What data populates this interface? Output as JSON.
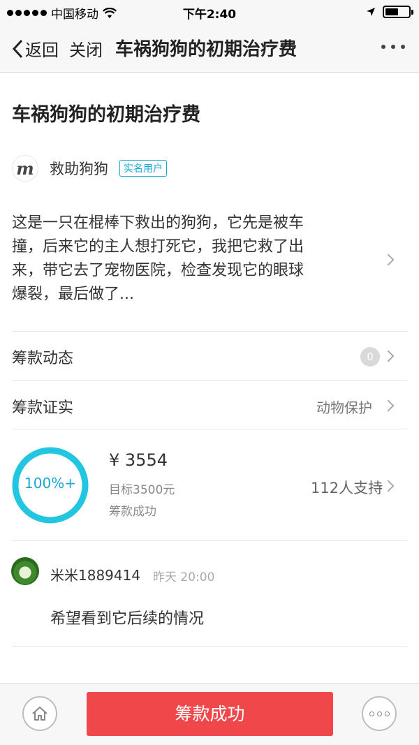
{
  "status_bar": {
    "carrier": "中国移动",
    "time": "下午2:40"
  },
  "nav": {
    "back_label": "返回",
    "close_label": "关闭",
    "title": "车祸狗狗的初期治疗费"
  },
  "post": {
    "title": "车祸狗狗的初期治疗费",
    "author": {
      "logo_letter": "m",
      "name": "救助狗狗",
      "badge": "实名用户"
    },
    "description_lines": [
      "这是一只在棍棒下救出的狗狗，它先是被车",
      "撞，后来它的主人想打死它，我把它救了出",
      "来，带它去了宠物医院，检查发现它的眼球",
      "爆裂，最后做了..."
    ]
  },
  "rows": {
    "updates": {
      "label": "筹款动态",
      "count": "0"
    },
    "verify": {
      "label": "筹款证实",
      "value": "动物保护"
    }
  },
  "progress": {
    "percent_label": "100%+",
    "fill_fraction": 1.0,
    "amount": "¥ 3554",
    "target": "目标3500元",
    "status": "筹款成功",
    "supporters": "112人支持",
    "ring_color": "#22c6e0"
  },
  "comment": {
    "user": "米米1889414",
    "time": "昨天 20:00",
    "text": "希望看到它后续的情况"
  },
  "bottom": {
    "main_button": "筹款成功",
    "main_color": "#f0484a",
    "home_icon": "home-icon",
    "more_icon": "more-icon"
  }
}
